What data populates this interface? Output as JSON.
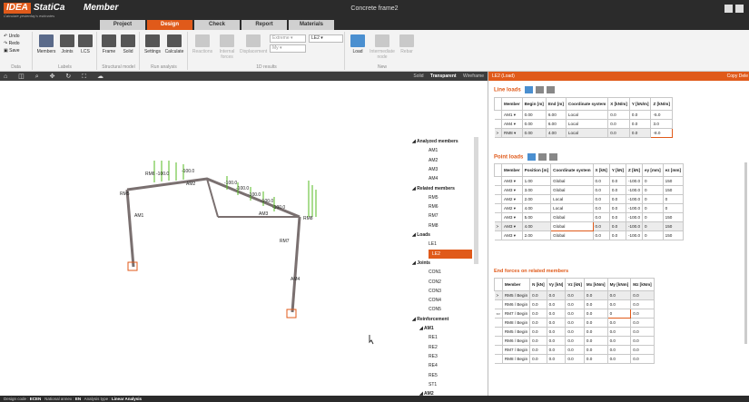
{
  "app": {
    "logo": "IDEA",
    "name": "StatiCa",
    "module": "Member",
    "tagline": "Calculate yesterday's estimates",
    "window_title": "Concrete frame2"
  },
  "tabs": [
    "Project",
    "Design",
    "Check",
    "Report",
    "Materials"
  ],
  "active_tab": "Design",
  "ribbon": {
    "undo": "Undo",
    "redo": "Redo",
    "save": "Save",
    "groups": {
      "data": "Data",
      "labels": "Labels",
      "structural": "Structural model",
      "run": "Run analysis",
      "results": "1D results",
      "new": "New"
    },
    "buttons": {
      "members": "Members",
      "joints": "Joints",
      "lcs": "LCS",
      "frame": "Frame",
      "solid": "Solid",
      "settings": "Settings",
      "calculate": "Calculate",
      "reactions": "Reactions",
      "internal": "Internal forces",
      "displacement": "Displacement",
      "load": "Load",
      "intermediate": "Intermediate node",
      "rebar": "Rebar"
    },
    "dropdowns": {
      "extreme": "Extreme",
      "my": "My",
      "le2": "LE2"
    }
  },
  "viewport": {
    "modes": [
      "Solid",
      "Transparent",
      "Wireframe"
    ],
    "active_mode": "Transparent"
  },
  "tree": {
    "items": [
      {
        "label": "Analyzed members",
        "type": "head"
      },
      {
        "label": "AM1"
      },
      {
        "label": "AM2"
      },
      {
        "label": "AM3"
      },
      {
        "label": "AM4"
      },
      {
        "label": "Related members",
        "type": "head"
      },
      {
        "label": "RM5"
      },
      {
        "label": "RM6"
      },
      {
        "label": "RM7"
      },
      {
        "label": "RM8"
      },
      {
        "label": "Loads",
        "type": "head"
      },
      {
        "label": "LE1"
      },
      {
        "label": "LE2",
        "selected": true
      },
      {
        "label": "Joints",
        "type": "head"
      },
      {
        "label": "CON1"
      },
      {
        "label": "CON2"
      },
      {
        "label": "CON3"
      },
      {
        "label": "CON4"
      },
      {
        "label": "CON5"
      },
      {
        "label": "Reinforcement",
        "type": "head"
      },
      {
        "label": "AM1",
        "type": "sub"
      },
      {
        "label": "RE1"
      },
      {
        "label": "RE2"
      },
      {
        "label": "RE3"
      },
      {
        "label": "RE4"
      },
      {
        "label": "RE5"
      },
      {
        "label": "ST1"
      },
      {
        "label": "AM2",
        "type": "sub"
      }
    ]
  },
  "panel": {
    "title": "LE2 (Load)",
    "right_tabs": "Copy  Dele",
    "line_loads": {
      "title": "Line loads",
      "headers": [
        "Member",
        "Begin [m]",
        "End [m]",
        "Coordinate system",
        "X [kN/m]",
        "Y [kN/m]",
        "Z [kN/m]"
      ],
      "rows": [
        [
          "AM1 ▾",
          "0.00",
          "6.00",
          "Local",
          "0.0",
          "0.0",
          "-5.0"
        ],
        [
          "AM4 ▾",
          "0.00",
          "6.00",
          "Local",
          "0.0",
          "0.0",
          "3.0"
        ],
        [
          "RM8 ▾",
          "0.00",
          "4.00",
          "Local",
          "0.0",
          "0.0",
          "-8.0"
        ]
      ]
    },
    "point_loads": {
      "title": "Point loads",
      "headers": [
        "Member",
        "Position [m]",
        "Coordinate system",
        "X [kN]",
        "Y [kN]",
        "Z [kN]",
        "ey [mm]",
        "ez [mm]"
      ],
      "rows": [
        [
          "AM3 ▾",
          "1.00",
          "Global",
          "0.0",
          "0.0",
          "-100.0",
          "0",
          "150"
        ],
        [
          "AM3 ▾",
          "3.00",
          "Global",
          "0.0",
          "0.0",
          "-100.0",
          "0",
          "150"
        ],
        [
          "AM2 ▾",
          "2.00",
          "Local",
          "0.0",
          "0.0",
          "-100.0",
          "0",
          "0"
        ],
        [
          "AM2 ▾",
          "4.00",
          "Local",
          "0.0",
          "0.0",
          "-100.0",
          "0",
          "0"
        ],
        [
          "AM3 ▾",
          "5.00",
          "Global",
          "0.0",
          "0.0",
          "-100.0",
          "0",
          "150"
        ],
        [
          "AM3 ▾",
          "4.00",
          "Global",
          "0.0",
          "0.0",
          "-100.0",
          "0",
          "150"
        ],
        [
          "AM3 ▾",
          "2.00",
          "Global",
          "0.0",
          "0.0",
          "-100.0",
          "0",
          "150"
        ]
      ]
    },
    "end_forces": {
      "title": "End forces on related members",
      "headers": [
        "Member",
        "N [kN]",
        "Vy [kN]",
        "Vz [kN]",
        "Mx [kNm]",
        "My [kNm]",
        "Mz [kNm]"
      ],
      "rows": [
        [
          "RM5 / Begin",
          "0.0",
          "0.0",
          "0.0",
          "0.0",
          "0.0",
          "0.0"
        ],
        [
          "RM6 / Begin",
          "0.0",
          "0.0",
          "0.0",
          "0.0",
          "0.0",
          "0.0"
        ],
        [
          "RM7 / Begin",
          "0.0",
          "0.0",
          "0.0",
          "0.0",
          "0",
          "0.0"
        ],
        [
          "RM8 / Begin",
          "0.0",
          "0.0",
          "0.0",
          "0.0",
          "0.0",
          "0.0"
        ],
        [
          "RM5 / Begin",
          "0.0",
          "0.0",
          "0.0",
          "0.0",
          "0.0",
          "0.0"
        ],
        [
          "RM6 / Begin",
          "0.0",
          "0.0",
          "0.0",
          "0.0",
          "0.0",
          "0.0"
        ],
        [
          "RM7 / Begin",
          "0.0",
          "0.0",
          "0.0",
          "0.0",
          "0.0",
          "0.0"
        ],
        [
          "RM8 / Begin",
          "0.0",
          "0.0",
          "0.0",
          "0.0",
          "0.0",
          "0.0"
        ]
      ]
    }
  },
  "model_labels": {
    "members": [
      "RM5",
      "AM1",
      "AM2",
      "AM3",
      "AM4",
      "RM6",
      "RM7",
      "RM8"
    ],
    "loads": [
      "-100.0",
      "-100.0",
      "-100.0",
      "-100.0",
      "-100.0",
      "-100.0",
      "-100.0"
    ],
    "axes": [
      "Z",
      "X",
      "Y",
      "Z",
      "X"
    ]
  },
  "status": {
    "design_code_label": "Design code :",
    "design_code": "ECEN",
    "annex_label": "National annex :",
    "annex": "EN",
    "analysis_label": "Analysis type :",
    "analysis": "Linear Analysis"
  },
  "colors": {
    "accent": "#e05a1a",
    "dark": "#2b2b2b",
    "load": "#55bb22"
  }
}
